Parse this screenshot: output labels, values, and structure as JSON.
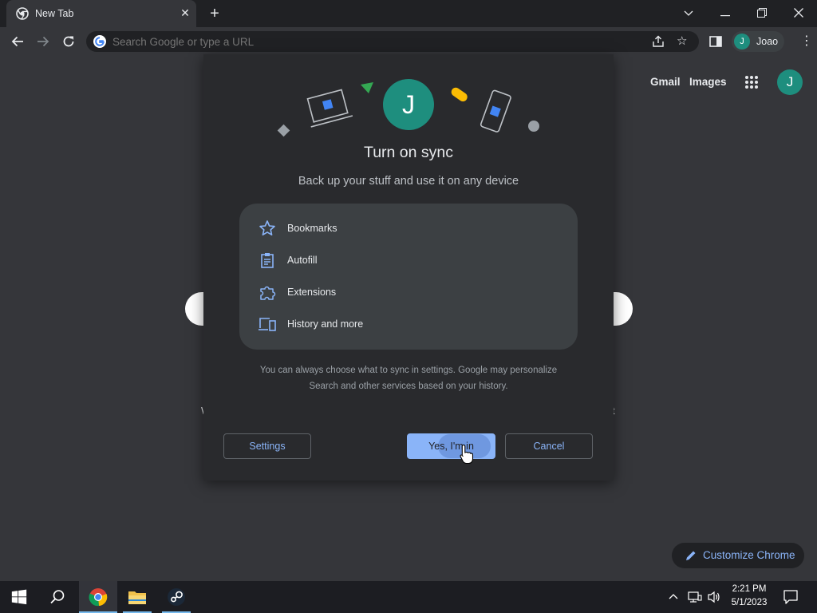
{
  "browser": {
    "tab_title": "New Tab",
    "omnibox_placeholder": "Search Google or type a URL",
    "profile_name": "Joao",
    "profile_initial": "J"
  },
  "ntp": {
    "gmail_label": "Gmail",
    "images_label": "Images",
    "avatar_initial": "J",
    "customize_label": "Customize Chrome",
    "ghost_left": "W",
    "ghost_right": "t"
  },
  "dialog": {
    "avatar_initial": "J",
    "title": "Turn on sync",
    "subtitle": "Back up your stuff and use it on any device",
    "features": [
      {
        "icon": "star-icon",
        "label": "Bookmarks"
      },
      {
        "icon": "clipboard-icon",
        "label": "Autofill"
      },
      {
        "icon": "puzzle-icon",
        "label": "Extensions"
      },
      {
        "icon": "devices-icon",
        "label": "History and more"
      }
    ],
    "disclaimer_line1": "You can always choose what to sync in settings. Google may personalize",
    "disclaimer_line2": "Search and other services based on your history.",
    "settings_label": "Settings",
    "confirm_label": "Yes, I'm in",
    "cancel_label": "Cancel"
  },
  "taskbar": {
    "time": "2:21 PM",
    "date": "5/1/2023",
    "pinned": [
      "start-icon",
      "search-icon",
      "chrome-icon",
      "file-explorer-icon",
      "steam-icon"
    ]
  },
  "colors": {
    "accent": "#8ab4f8",
    "avatar": "#1e8e7e",
    "dialog_bg": "#292a2d"
  }
}
